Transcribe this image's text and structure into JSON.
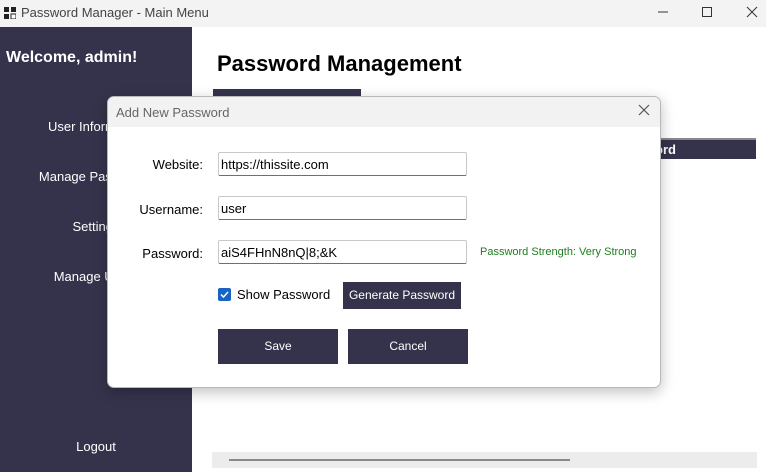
{
  "window": {
    "title": "Password Manager - Main Menu"
  },
  "sidebar": {
    "welcome": "Welcome, admin!",
    "items": [
      {
        "label": "User Information"
      },
      {
        "label": "Manage Passwords"
      },
      {
        "label": "Settings"
      },
      {
        "label": "Manage Users"
      }
    ],
    "logout": "Logout"
  },
  "main": {
    "title": "Password Management",
    "table": {
      "columns": [
        "Password"
      ]
    }
  },
  "dialog": {
    "title": "Add New Password",
    "website_label": "Website:",
    "website_value": "https://thissite.com",
    "username_label": "Username:",
    "username_value": "user",
    "password_label": "Password:",
    "password_value": "aiS4FHnN8nQ|8;&K",
    "strength": "Password Strength: Very Strong",
    "show_password_label": "Show Password",
    "show_password_checked": true,
    "generate_label": "Generate Password",
    "save_label": "Save",
    "cancel_label": "Cancel"
  },
  "colors": {
    "sidebar_bg": "#34334b",
    "button_bg": "#34334b",
    "strength_text": "#1e7d1e",
    "checkbox_accent": "#1863c6"
  }
}
